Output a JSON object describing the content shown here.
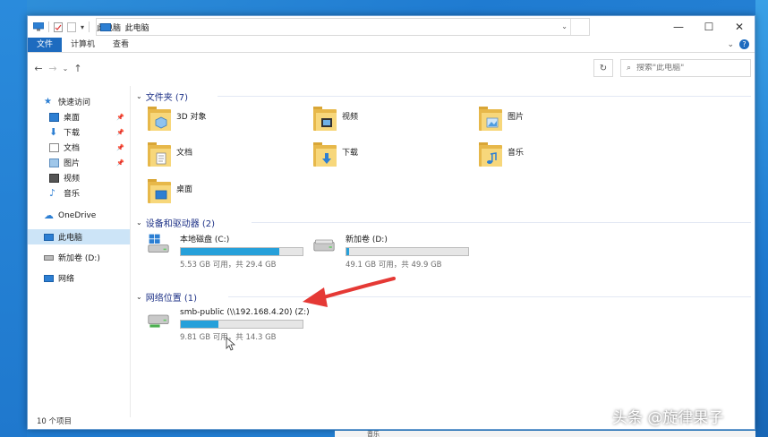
{
  "window": {
    "title": "此电脑",
    "controls": {
      "minimize": "—",
      "maximize": "☐",
      "close": "✕"
    }
  },
  "ribbon": {
    "tabs": [
      "文件",
      "计算机",
      "查看"
    ],
    "expand": "⌄",
    "help": "?"
  },
  "nav": {
    "back": "←",
    "forward": "→",
    "recent": "⌄",
    "up": "↑",
    "path_sep": "›",
    "path": "此电脑",
    "dropdown": "⌄",
    "refresh": "↻"
  },
  "search": {
    "icon": "⌕",
    "placeholder": "搜索\"此电脑\""
  },
  "sidebar": {
    "quick_access": "快速访问",
    "pinned": [
      {
        "label": "桌面",
        "icon": "desktop-icon"
      },
      {
        "label": "下载",
        "icon": "download-icon"
      },
      {
        "label": "文档",
        "icon": "document-icon"
      },
      {
        "label": "图片",
        "icon": "picture-icon"
      }
    ],
    "recent": [
      {
        "label": "视频",
        "icon": "video-icon"
      },
      {
        "label": "音乐",
        "icon": "music-icon"
      }
    ],
    "pin_glyph": "📌",
    "onedrive": "OneDrive",
    "this_pc": "此电脑",
    "new_volume": "新加卷 (D:)",
    "network": "网络"
  },
  "groups": {
    "folders_header": "文件夹 (7)",
    "devices_header": "设备和驱动器 (2)",
    "network_header": "网络位置 (1)",
    "chev": "⌄"
  },
  "folders": [
    {
      "label": "3D 对象",
      "icon": "3d-objects-folder-icon"
    },
    {
      "label": "视频",
      "icon": "video-folder-icon"
    },
    {
      "label": "图片",
      "icon": "pictures-folder-icon"
    },
    {
      "label": "文档",
      "icon": "documents-folder-icon"
    },
    {
      "label": "下载",
      "icon": "downloads-folder-icon"
    },
    {
      "label": "音乐",
      "icon": "music-folder-icon"
    },
    {
      "label": "桌面",
      "icon": "desktop-folder-icon"
    }
  ],
  "drives": [
    {
      "name": "本地磁盘 (C:)",
      "usage": "5.53 GB 可用，共 29.4 GB",
      "used_fraction": 0.81
    },
    {
      "name": "新加卷 (D:)",
      "usage": "49.1 GB 可用，共 49.9 GB",
      "used_fraction": 0.02
    }
  ],
  "network_locations": [
    {
      "name": "smb-public (\\\\192.168.4.20) (Z:)",
      "usage": "9.81 GB 可用，共 14.3 GB",
      "used_fraction": 0.31
    }
  ],
  "status": {
    "count": "10 个项目"
  },
  "taskbar_peek": {
    "label": "音乐"
  },
  "watermark": "头条 @旋律果子",
  "colors": {
    "accent": "#1d6bbf",
    "bar_fill": "#26a0da",
    "group_header": "#1e3287",
    "selected": "#cce4f7",
    "annotation_arrow": "#e53935"
  }
}
